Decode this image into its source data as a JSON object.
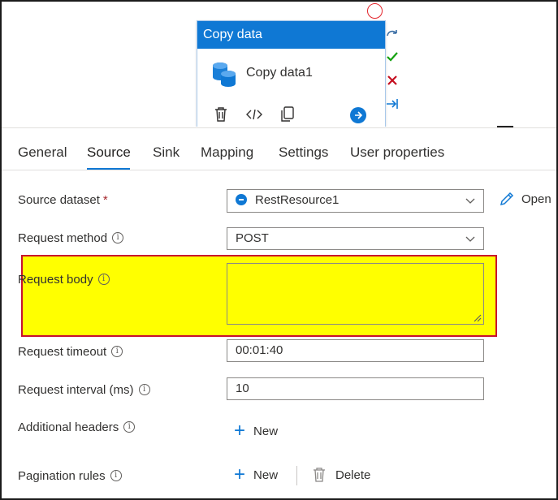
{
  "activity": {
    "header": "Copy data",
    "name": "Copy data1"
  },
  "tabs": [
    "General",
    "Source",
    "Sink",
    "Mapping",
    "Settings",
    "User properties"
  ],
  "active_tab": "Source",
  "form": {
    "source_dataset": {
      "label": "Source dataset",
      "required_mark": "*",
      "value": "RestResource1",
      "open_label": "Open"
    },
    "request_method": {
      "label": "Request method",
      "value": "POST"
    },
    "request_body": {
      "label": "Request body",
      "value": ""
    },
    "request_timeout": {
      "label": "Request timeout",
      "value": "00:01:40"
    },
    "request_interval": {
      "label": "Request interval (ms)",
      "value": "10"
    },
    "additional_headers": {
      "label": "Additional headers",
      "new_label": "New"
    },
    "pagination_rules": {
      "label": "Pagination rules",
      "new_label": "New",
      "delete_label": "Delete"
    }
  },
  "info_glyph": "i",
  "colors": {
    "accent": "#0f78d4",
    "highlight": "#ffff00",
    "highlight_border": "#c8102e",
    "success": "#13a10e",
    "error": "#c50f1f"
  }
}
